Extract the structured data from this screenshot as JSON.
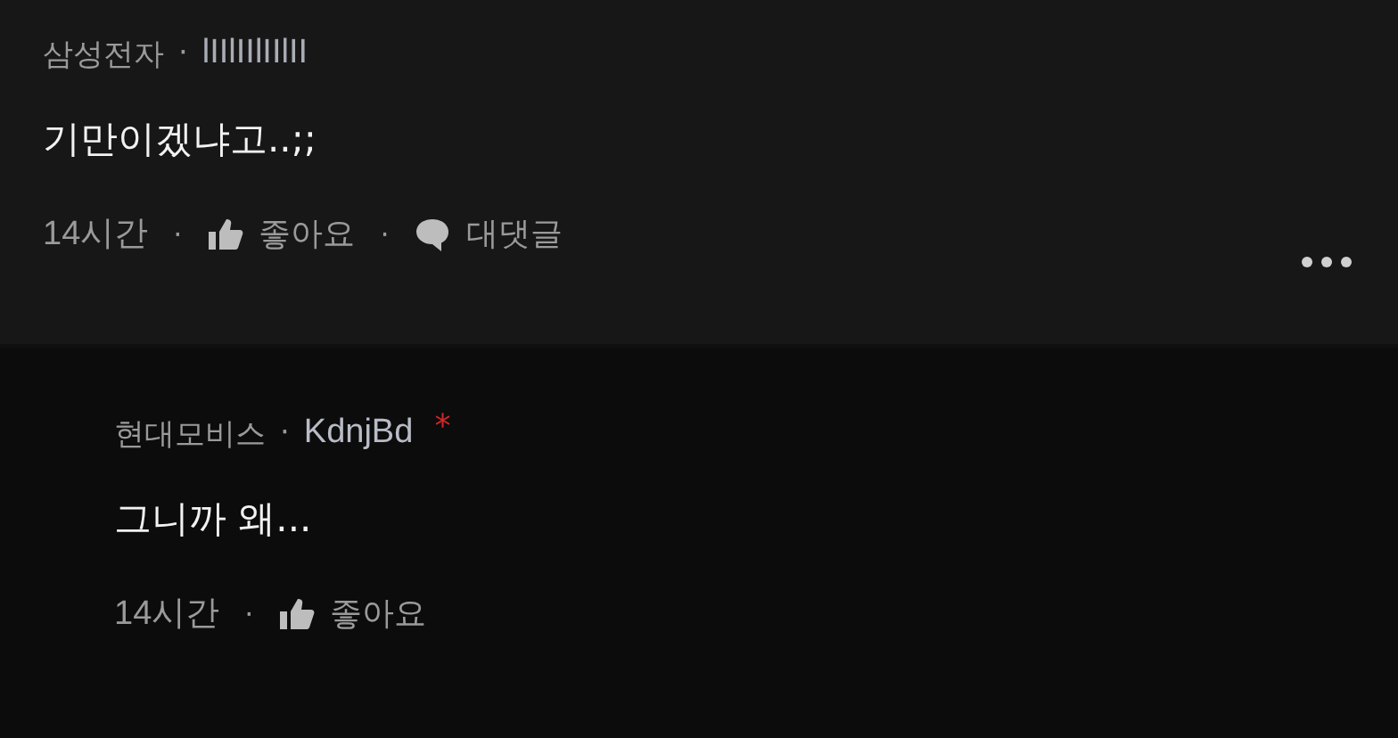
{
  "comments": [
    {
      "company": "삼성전자",
      "separator": "·",
      "author": "lIIlIIlIIlII",
      "text": "기만이겠냐고..;;",
      "time": "14시간",
      "like_label": "좋아요",
      "reply_label": "대댓글",
      "has_more": true,
      "kind": "comment"
    },
    {
      "company": "현대모비스",
      "separator": "·",
      "author": "KdnjBd",
      "text": "그니까 왜...",
      "time": "14시간",
      "like_label": "좋아요",
      "has_more": false,
      "kind": "reply",
      "badge": "*"
    }
  ]
}
